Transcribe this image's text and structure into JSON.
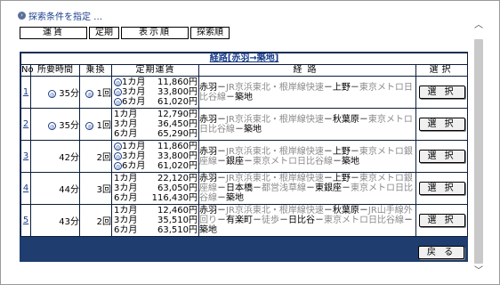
{
  "search_conditions": {
    "icon": "circle-arrow-icon",
    "label": "探索条件を指定 …"
  },
  "tabs": [
    {
      "label": "運賃"
    },
    {
      "label": "定期"
    },
    {
      "label": "表示順"
    },
    {
      "label": "探索順"
    }
  ],
  "results": {
    "title": "経路[赤羽→築地]",
    "headers": {
      "no": "No",
      "time": "所要時間",
      "transfers": "乗換",
      "fare": "定期運賃",
      "route": "経路",
      "select": "選択"
    },
    "rows": [
      {
        "no": "1",
        "time": "35分",
        "time_mark": "◎",
        "transfers": "1回",
        "transfer_mark": "◎",
        "fares": [
          {
            "mark": "◎",
            "period": "1カ月",
            "price": "11,860円"
          },
          {
            "mark": "◎",
            "period": "3カ月",
            "price": "33,800円"
          },
          {
            "mark": "◎",
            "period": "6カ月",
            "price": "61,020円"
          }
        ],
        "route": [
          {
            "t": "赤羽－",
            "g": false
          },
          {
            "t": "JR京浜東北・根岸線快速",
            "g": true
          },
          {
            "t": "－上野－",
            "g": false
          },
          {
            "t": "東京メトロ日比谷線",
            "g": true
          },
          {
            "t": "－築地",
            "g": false
          }
        ],
        "select": "選 択"
      },
      {
        "no": "2",
        "time": "35分",
        "time_mark": "◎",
        "transfers": "1回",
        "transfer_mark": "◎",
        "fares": [
          {
            "mark": "",
            "period": "1カ月",
            "price": "12,790円"
          },
          {
            "mark": "",
            "period": "3カ月",
            "price": "36,450円"
          },
          {
            "mark": "",
            "period": "6カ月",
            "price": "65,290円"
          }
        ],
        "route": [
          {
            "t": "赤羽－",
            "g": false
          },
          {
            "t": "JR京浜東北・根岸線快速",
            "g": true
          },
          {
            "t": "－秋葉原－",
            "g": false
          },
          {
            "t": "東京メトロ日比谷線",
            "g": true
          },
          {
            "t": "－築地",
            "g": false
          }
        ],
        "select": "選 択"
      },
      {
        "no": "3",
        "time": "42分",
        "time_mark": "",
        "transfers": "2回",
        "transfer_mark": "",
        "fares": [
          {
            "mark": "◎",
            "period": "1カ月",
            "price": "11,860円"
          },
          {
            "mark": "◎",
            "period": "3カ月",
            "price": "33,800円"
          },
          {
            "mark": "◎",
            "period": "6カ月",
            "price": "61,020円"
          }
        ],
        "route": [
          {
            "t": "赤羽－",
            "g": false
          },
          {
            "t": "JR京浜東北・根岸線快速",
            "g": true
          },
          {
            "t": "－上野－",
            "g": false
          },
          {
            "t": "東京メトロ銀座線",
            "g": true
          },
          {
            "t": "－銀座－",
            "g": false
          },
          {
            "t": "東京メトロ日比谷線",
            "g": true
          },
          {
            "t": "－築地",
            "g": false
          }
        ],
        "select": "選 択"
      },
      {
        "no": "4",
        "time": "44分",
        "time_mark": "",
        "transfers": "3回",
        "transfer_mark": "",
        "fares": [
          {
            "mark": "",
            "period": "1カ月",
            "price": "22,120円"
          },
          {
            "mark": "",
            "period": "3カ月",
            "price": "63,050円"
          },
          {
            "mark": "",
            "period": "6カ月",
            "price": "116,430円"
          }
        ],
        "route": [
          {
            "t": "赤羽－",
            "g": false
          },
          {
            "t": "JR京浜東北・根岸線快速",
            "g": true
          },
          {
            "t": "－上野－",
            "g": false
          },
          {
            "t": "東京メトロ銀座線",
            "g": true
          },
          {
            "t": "－日本橋－",
            "g": false
          },
          {
            "t": "都営浅草線",
            "g": true
          },
          {
            "t": "－東銀座－",
            "g": false
          },
          {
            "t": "東京メトロ日比谷線",
            "g": true
          },
          {
            "t": "－築地",
            "g": false
          }
        ],
        "select": "選 択"
      },
      {
        "no": "5",
        "time": "43分",
        "time_mark": "",
        "transfers": "2回",
        "transfer_mark": "",
        "fares": [
          {
            "mark": "",
            "period": "1カ月",
            "price": "12,460円"
          },
          {
            "mark": "",
            "period": "3カ月",
            "price": "35,510円"
          },
          {
            "mark": "",
            "period": "6カ月",
            "price": "63,510円"
          }
        ],
        "route": [
          {
            "t": "赤羽－",
            "g": false
          },
          {
            "t": "JR京浜東北・根岸線快速",
            "g": true
          },
          {
            "t": "－秋葉原－",
            "g": false
          },
          {
            "t": "JR山手線外回り",
            "g": true
          },
          {
            "t": "－有楽町－",
            "g": false
          },
          {
            "t": "徒歩",
            "g": true
          },
          {
            "t": "－日比谷－",
            "g": false
          },
          {
            "t": "東京メトロ日比谷線",
            "g": true
          },
          {
            "t": "－築地",
            "g": false
          }
        ],
        "select": "選 択"
      }
    ],
    "back_label": "戻 る"
  },
  "scrollbar": {
    "up_icon": "scroll-up-arrow-icon",
    "down_icon": "scroll-down-arrow-icon"
  }
}
